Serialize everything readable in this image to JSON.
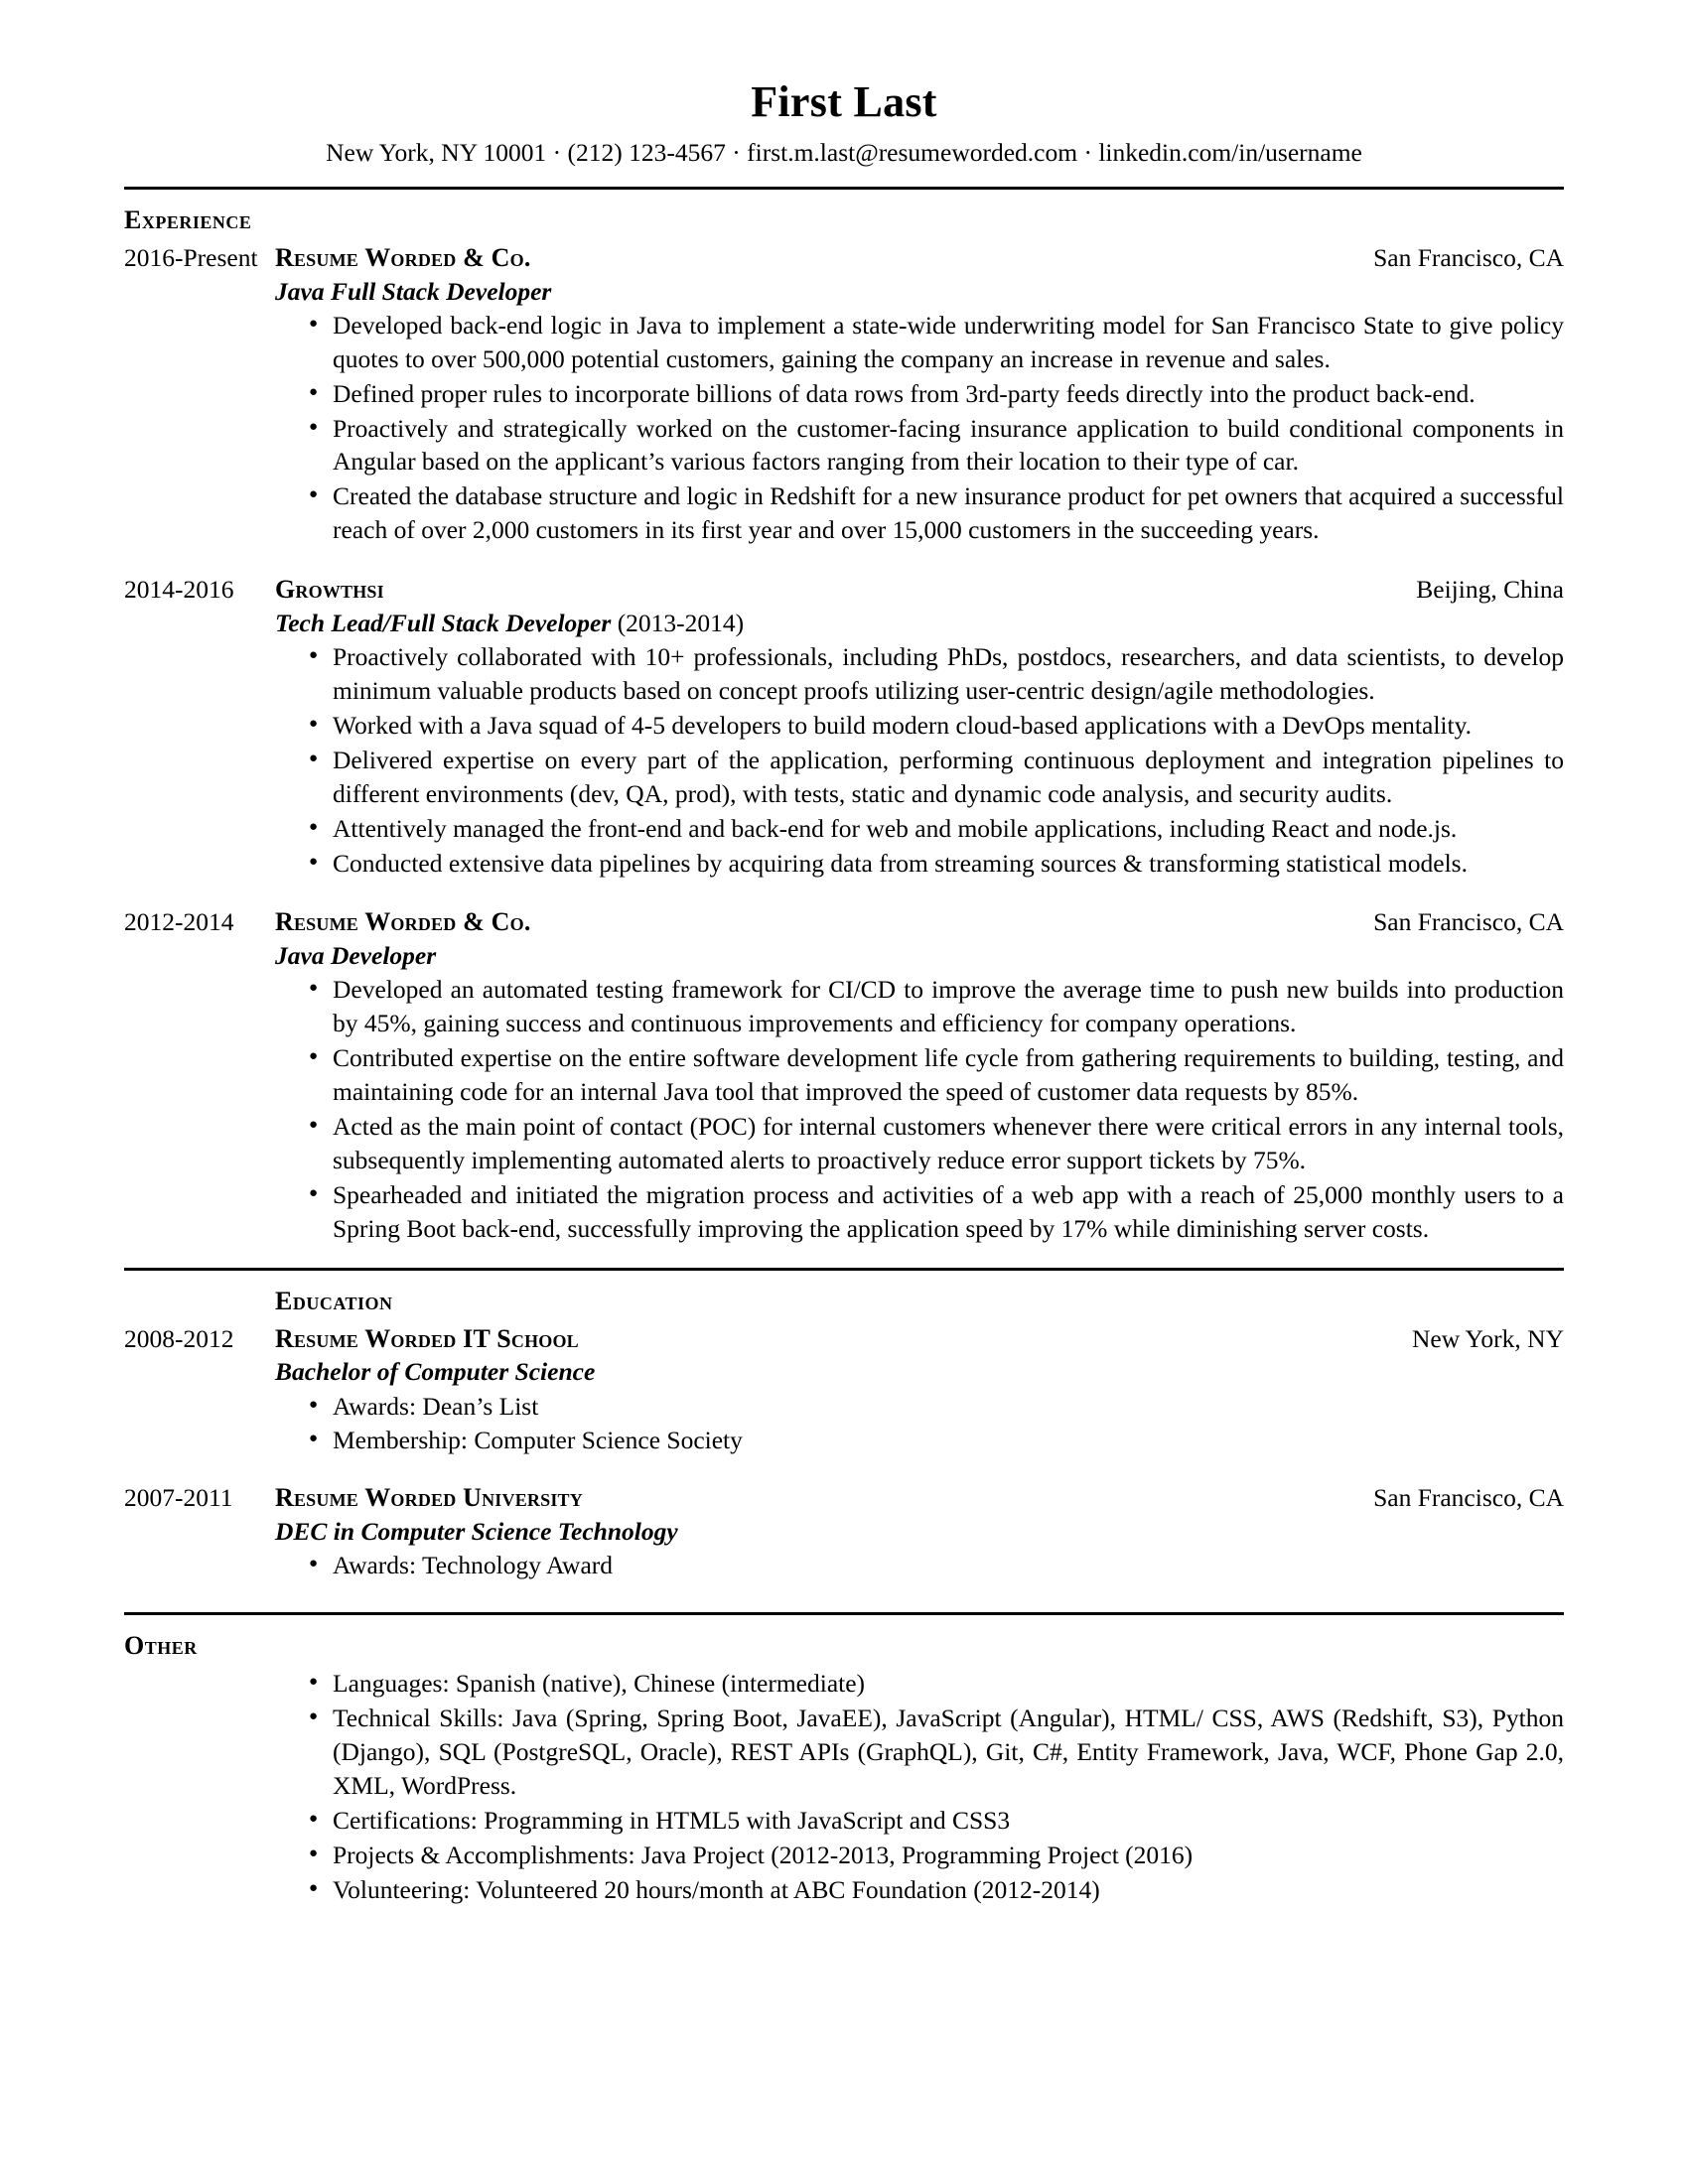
{
  "header": {
    "name": "First Last",
    "contact": "New York, NY 10001 · (212) 123-4567 · first.m.last@resumeworded.com · linkedin.com/in/username"
  },
  "sections": {
    "experience_label": "Experience",
    "education_label": "Education",
    "other_label": "Other"
  },
  "experience": [
    {
      "dates": "2016-Present",
      "org": "Resume Worded & Co.",
      "location": "San Francisco, CA",
      "title": "Java Full Stack Developer",
      "title_extra": "",
      "bullets": [
        "Developed back-end logic in Java to implement a state-wide underwriting model for San Francisco State to give policy quotes to over 500,000 potential customers, gaining the company an increase in revenue and sales.",
        "Defined proper rules to incorporate billions of data rows from 3rd-party feeds directly into the product back-end.",
        "Proactively and strategically worked on the customer-facing insurance application to build conditional components in Angular based on  the applicant’s various factors ranging from their location to their type of car.",
        "Created the database structure and logic in Redshift for a new insurance product for pet owners that acquired a successful reach of over 2,000 customers in its first year and over 15,000 customers in the succeeding years."
      ]
    },
    {
      "dates": "2014-2016",
      "org": "Growthsi",
      "location": "Beijing, China",
      "title": "Tech Lead/Full Stack Developer",
      "title_extra": " (2013-2014)",
      "bullets": [
        "Proactively collaborated with 10+ professionals, including PhDs, postdocs, researchers, and data scientists, to develop minimum valuable products based on concept proofs utilizing user-centric design/agile methodologies.",
        "Worked with a Java squad of 4-5 developers to build modern cloud-based applications with a DevOps mentality.",
        "Delivered expertise on every part of the application, performing continuous deployment and integration pipelines to different environments (dev, QA, prod), with tests, static and dynamic code analysis, and security audits.",
        "Attentively managed the front-end and back-end for web and mobile applications, including React and node.js.",
        "Conducted extensive data pipelines by acquiring data from streaming sources & transforming statistical models."
      ]
    },
    {
      "dates": "2012-2014",
      "org": "Resume Worded & Co.",
      "location": "San Francisco, CA",
      "title": "Java Developer",
      "title_extra": "",
      "bullets": [
        "Developed an automated testing framework for CI/CD to improve the average time to push new builds into production by 45%, gaining success and continuous improvements and efficiency for company operations.",
        "Contributed expertise on the entire software development life cycle from gathering requirements to building, testing, and maintaining code for an internal Java tool that improved the speed of customer data requests by 85%.",
        "Acted as the main point of contact (POC) for internal customers whenever there were critical errors in any internal tools, subsequently implementing automated alerts to proactively reduce error support tickets by 75%.",
        "Spearheaded and initiated the migration process and activities of a web app with a reach of 25,000 monthly users to a Spring Boot back-end, successfully improving the application speed by 17% while diminishing server costs."
      ]
    }
  ],
  "education": [
    {
      "dates": "2008-2012",
      "org": "Resume Worded IT School",
      "location": "New York, NY",
      "title": "Bachelor of Computer Science",
      "bullets": [
        "Awards: Dean’s List",
        "Membership: Computer Science Society"
      ]
    },
    {
      "dates": "2007-2011",
      "org": "Resume Worded University",
      "location": "San Francisco, CA",
      "title": "DEC in Computer Science Technology",
      "bullets": [
        "Awards: Technology Award"
      ]
    }
  ],
  "other": {
    "bullets": [
      "Languages: Spanish (native), Chinese (intermediate)",
      "Technical Skills: Java (Spring, Spring Boot, JavaEE), JavaScript (Angular), HTML/ CSS, AWS (Redshift, S3), Python (Django), SQL (PostgreSQL, Oracle), REST APIs (GraphQL), Git, C#, Entity Framework, Java, WCF, Phone Gap 2.0, XML, WordPress.",
      "Certifications: Programming in HTML5 with JavaScript and CSS3",
      "Projects & Accomplishments: Java Project (2012-2013, Programming Project (2016)",
      "Volunteering: Volunteered 20 hours/month at ABC Foundation (2012-2014)"
    ]
  }
}
